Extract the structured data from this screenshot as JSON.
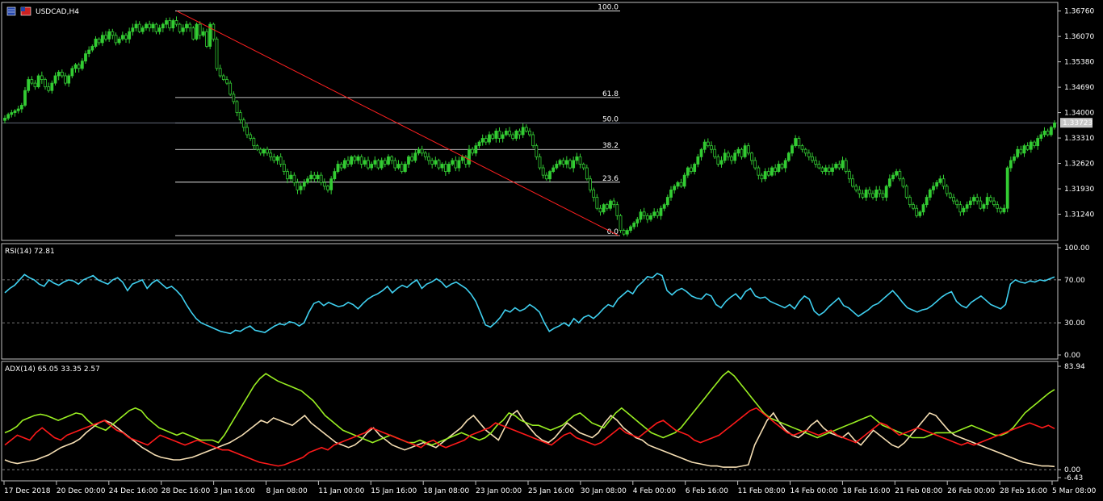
{
  "window": {
    "title": "USDCAD,H4"
  },
  "colors": {
    "background": "#000000",
    "frame": "#c0c0c0",
    "candle": "#33cc33",
    "candle_fill_down": "#000000",
    "fib": "#ffffff",
    "trendline": "#ff2020",
    "rsi": "#3fd0f0",
    "adx_main": "#f5deb3",
    "adx_plus": "#99ee22",
    "adx_minus": "#ff1a1a",
    "price_marker_bg": "#c8c8c8",
    "price_marker_text": "#000000"
  },
  "chart_data": [
    {
      "type": "candlestick",
      "title": "USDCAD,H4",
      "ylim": [
        1.3055,
        1.3695
      ],
      "yticks": [
        "1.36760",
        "1.36070",
        "1.35380",
        "1.34690",
        "1.34000",
        "1.33310",
        "1.32620",
        "1.31930",
        "1.31240"
      ],
      "ytick_values": [
        1.3676,
        1.3607,
        1.3538,
        1.3469,
        1.34,
        1.3331,
        1.3262,
        1.3193,
        1.3124
      ],
      "current_price": {
        "label": "1.33723",
        "value": 1.33723
      },
      "fibonacci": [
        {
          "label": "100.0",
          "price": 1.3676
        },
        {
          "label": "61.8",
          "price": 1.3441
        },
        {
          "label": "50.0",
          "price": 1.3372
        },
        {
          "label": "38.2",
          "price": 1.33
        },
        {
          "label": "23.6",
          "price": 1.3211
        },
        {
          "label": "0.0",
          "price": 1.3066
        }
      ],
      "closes": [
        1.3385,
        1.3395,
        1.34,
        1.3405,
        1.341,
        1.342,
        1.346,
        1.349,
        1.348,
        1.347,
        1.35,
        1.349,
        1.347,
        1.346,
        1.348,
        1.35,
        1.351,
        1.35,
        1.348,
        1.35,
        1.352,
        1.353,
        1.352,
        1.354,
        1.356,
        1.357,
        1.358,
        1.36,
        1.359,
        1.361,
        1.36,
        1.362,
        1.361,
        1.359,
        1.36,
        1.361,
        1.36,
        1.362,
        1.363,
        1.364,
        1.362,
        1.363,
        1.364,
        1.363,
        1.364,
        1.362,
        1.363,
        1.364,
        1.365,
        1.363,
        1.365,
        1.364,
        1.362,
        1.363,
        1.364,
        1.363,
        1.36,
        1.364,
        1.361,
        1.362,
        1.358,
        1.364,
        1.36,
        1.352,
        1.35,
        1.349,
        1.348,
        1.345,
        1.343,
        1.34,
        1.338,
        1.336,
        1.334,
        1.333,
        1.331,
        1.33,
        1.329,
        1.33,
        1.329,
        1.328,
        1.327,
        1.328,
        1.326,
        1.324,
        1.322,
        1.323,
        1.321,
        1.319,
        1.32,
        1.321,
        1.322,
        1.323,
        1.322,
        1.323,
        1.321,
        1.32,
        1.319,
        1.322,
        1.324,
        1.326,
        1.325,
        1.327,
        1.326,
        1.328,
        1.327,
        1.328,
        1.326,
        1.327,
        1.325,
        1.326,
        1.327,
        1.325,
        1.327,
        1.326,
        1.328,
        1.327,
        1.325,
        1.326,
        1.324,
        1.326,
        1.328,
        1.327,
        1.329,
        1.33,
        1.329,
        1.328,
        1.327,
        1.326,
        1.327,
        1.325,
        1.326,
        1.324,
        1.326,
        1.327,
        1.325,
        1.327,
        1.328,
        1.326,
        1.33,
        1.329,
        1.331,
        1.332,
        1.333,
        1.332,
        1.334,
        1.333,
        1.335,
        1.333,
        1.334,
        1.335,
        1.334,
        1.333,
        1.335,
        1.334,
        1.336,
        1.335,
        1.334,
        1.331,
        1.328,
        1.325,
        1.323,
        1.322,
        1.324,
        1.325,
        1.326,
        1.327,
        1.326,
        1.327,
        1.325,
        1.327,
        1.328,
        1.326,
        1.325,
        1.322,
        1.319,
        1.317,
        1.314,
        1.313,
        1.315,
        1.314,
        1.316,
        1.315,
        1.312,
        1.308,
        1.307,
        1.308,
        1.309,
        1.31,
        1.311,
        1.313,
        1.312,
        1.311,
        1.312,
        1.313,
        1.312,
        1.314,
        1.315,
        1.317,
        1.319,
        1.32,
        1.321,
        1.32,
        1.323,
        1.325,
        1.324,
        1.326,
        1.328,
        1.33,
        1.332,
        1.331,
        1.33,
        1.328,
        1.326,
        1.327,
        1.329,
        1.328,
        1.327,
        1.329,
        1.33,
        1.328,
        1.331,
        1.329,
        1.327,
        1.325,
        1.323,
        1.322,
        1.324,
        1.323,
        1.325,
        1.324,
        1.326,
        1.325,
        1.327,
        1.329,
        1.331,
        1.333,
        1.331,
        1.33,
        1.329,
        1.328,
        1.327,
        1.326,
        1.325,
        1.324,
        1.325,
        1.324,
        1.325,
        1.326,
        1.325,
        1.327,
        1.324,
        1.322,
        1.32,
        1.319,
        1.318,
        1.317,
        1.319,
        1.318,
        1.317,
        1.319,
        1.318,
        1.317,
        1.32,
        1.322,
        1.323,
        1.324,
        1.322,
        1.32,
        1.317,
        1.315,
        1.314,
        1.312,
        1.313,
        1.315,
        1.317,
        1.319,
        1.32,
        1.321,
        1.322,
        1.32,
        1.318,
        1.317,
        1.316,
        1.315,
        1.313,
        1.314,
        1.315,
        1.316,
        1.317,
        1.316,
        1.314,
        1.315,
        1.317,
        1.316,
        1.315,
        1.314,
        1.313,
        1.314,
        1.325,
        1.327,
        1.328,
        1.33,
        1.329,
        1.331,
        1.33,
        1.332,
        1.331,
        1.333,
        1.334,
        1.335,
        1.334,
        1.336,
        1.3372
      ]
    },
    {
      "type": "line",
      "title": "RSI(14) 72.81",
      "ylim": [
        0,
        100
      ],
      "yticks": [
        "100.00",
        "70.00",
        "30.00",
        "0.00"
      ],
      "ytick_values": [
        100,
        70,
        30,
        0
      ],
      "levels": [
        70,
        30
      ],
      "series": [
        {
          "values": [
            58,
            62,
            65,
            70,
            75,
            72,
            70,
            66,
            64,
            70,
            67,
            65,
            68,
            70,
            69,
            66,
            70,
            72,
            74,
            70,
            68,
            66,
            70,
            72,
            68,
            60,
            66,
            68,
            70,
            62,
            67,
            70,
            66,
            62,
            64,
            60,
            55,
            47,
            40,
            34,
            30,
            28,
            26,
            24,
            22,
            21,
            20,
            23,
            22,
            25,
            27,
            23,
            22,
            21,
            24,
            27,
            29,
            28,
            31,
            30,
            27,
            30,
            40,
            48,
            50,
            46,
            49,
            47,
            45,
            46,
            49,
            47,
            43,
            48,
            52,
            55,
            57,
            60,
            64,
            58,
            62,
            65,
            63,
            67,
            70,
            62,
            66,
            68,
            71,
            68,
            63,
            66,
            68,
            65,
            62,
            57,
            50,
            39,
            28,
            26,
            30,
            35,
            42,
            40,
            44,
            41,
            43,
            47,
            44,
            40,
            30,
            22,
            25,
            27,
            30,
            27,
            34,
            30,
            35,
            37,
            34,
            38,
            43,
            47,
            45,
            52,
            56,
            60,
            57,
            64,
            68,
            73,
            72,
            76,
            74,
            60,
            56,
            60,
            62,
            59,
            55,
            53,
            52,
            57,
            55,
            47,
            44,
            50,
            54,
            57,
            52,
            59,
            62,
            55,
            53,
            54,
            50,
            48,
            46,
            44,
            47,
            43,
            50,
            55,
            52,
            41,
            37,
            40,
            45,
            49,
            53,
            46,
            44,
            40,
            36,
            39,
            42,
            46,
            48,
            52,
            56,
            60,
            55,
            49,
            44,
            42,
            40,
            42,
            43,
            46,
            50,
            54,
            57,
            59,
            50,
            46,
            44,
            49,
            52,
            55,
            51,
            47,
            45,
            43,
            47,
            66,
            70,
            68,
            67,
            69,
            68,
            70,
            69,
            71,
            72.81
          ]
        }
      ]
    },
    {
      "type": "line",
      "title": "ADX(14) 65.05 33.35 2.57",
      "ylim": [
        -6.43,
        83.94
      ],
      "yticks": [
        "83.94",
        "0.00",
        "-6.43"
      ],
      "ytick_values": [
        83.94,
        0,
        -6.43
      ],
      "level": 0,
      "series": [
        {
          "values": [
            8,
            6,
            5,
            6,
            7,
            8,
            10,
            12,
            15,
            18,
            20,
            22,
            25,
            30,
            34,
            38,
            40,
            38,
            34,
            30,
            26,
            22,
            18,
            15,
            12,
            10,
            9,
            8,
            8,
            9,
            10,
            12,
            14,
            16,
            18,
            20,
            22,
            25,
            28,
            32,
            36,
            40,
            38,
            42,
            40,
            38,
            36,
            40,
            44,
            38,
            34,
            30,
            26,
            22,
            20,
            18,
            20,
            24,
            30,
            34,
            28,
            24,
            20,
            18,
            16,
            18,
            20,
            22,
            20,
            18,
            22,
            26,
            30,
            34,
            40,
            44,
            38,
            32,
            28,
            24,
            34,
            44,
            48,
            40,
            34,
            28,
            24,
            22,
            26,
            32,
            38,
            34,
            30,
            28,
            26,
            30,
            38,
            44,
            40,
            34,
            30,
            26,
            24,
            20,
            18,
            16,
            14,
            12,
            10,
            8,
            6,
            5,
            4,
            3,
            3,
            2,
            2,
            2,
            3,
            4,
            20,
            30,
            40,
            46,
            38,
            32,
            28,
            26,
            30,
            36,
            40,
            34,
            30,
            28,
            26,
            30,
            24,
            20,
            26,
            32,
            28,
            24,
            20,
            18,
            22,
            28,
            34,
            40,
            46,
            44,
            38,
            32,
            28,
            26,
            24,
            22,
            20,
            18,
            16,
            14,
            12,
            10,
            8,
            6,
            5,
            4,
            3,
            3,
            2.57
          ]
        },
        {
          "values": [
            30,
            32,
            35,
            40,
            42,
            44,
            45,
            44,
            42,
            40,
            42,
            44,
            46,
            45,
            40,
            36,
            34,
            32,
            36,
            40,
            44,
            48,
            50,
            48,
            42,
            38,
            34,
            32,
            30,
            28,
            30,
            28,
            26,
            24,
            24,
            24,
            22,
            28,
            36,
            44,
            52,
            60,
            68,
            74,
            78,
            75,
            72,
            70,
            68,
            66,
            64,
            60,
            56,
            50,
            44,
            40,
            36,
            32,
            30,
            28,
            26,
            24,
            22,
            24,
            26,
            28,
            26,
            24,
            22,
            22,
            24,
            22,
            20,
            22,
            24,
            26,
            28,
            30,
            28,
            26,
            24,
            26,
            30,
            36,
            40,
            46,
            44,
            40,
            38,
            36,
            36,
            34,
            32,
            34,
            36,
            40,
            44,
            46,
            42,
            38,
            36,
            34,
            40,
            46,
            50,
            46,
            42,
            38,
            34,
            30,
            28,
            26,
            28,
            30,
            34,
            40,
            46,
            52,
            58,
            64,
            70,
            76,
            80,
            76,
            70,
            64,
            58,
            52,
            46,
            42,
            40,
            38,
            36,
            34,
            32,
            30,
            28,
            26,
            28,
            30,
            32,
            34,
            36,
            38,
            40,
            42,
            44,
            40,
            36,
            34,
            32,
            30,
            28,
            26,
            26,
            26,
            28,
            30,
            30,
            30,
            30,
            32,
            34,
            36,
            34,
            32,
            30,
            28,
            28,
            30,
            34,
            40,
            46,
            50,
            54,
            58,
            62,
            65.05
          ]
        },
        {
          "values": [
            20,
            24,
            28,
            26,
            24,
            30,
            34,
            30,
            26,
            24,
            28,
            30,
            32,
            34,
            36,
            38,
            40,
            36,
            32,
            30,
            26,
            24,
            22,
            20,
            24,
            28,
            26,
            24,
            22,
            20,
            22,
            24,
            22,
            20,
            18,
            16,
            16,
            14,
            12,
            10,
            8,
            6,
            5,
            4,
            3,
            4,
            6,
            8,
            10,
            14,
            16,
            18,
            16,
            20,
            22,
            24,
            26,
            28,
            30,
            34,
            32,
            30,
            28,
            26,
            24,
            22,
            20,
            18,
            22,
            24,
            20,
            18,
            20,
            22,
            24,
            28,
            30,
            32,
            34,
            38,
            36,
            34,
            32,
            30,
            28,
            26,
            24,
            22,
            20,
            24,
            28,
            30,
            26,
            24,
            22,
            20,
            22,
            26,
            30,
            34,
            30,
            28,
            26,
            30,
            34,
            38,
            40,
            36,
            32,
            30,
            28,
            24,
            22,
            24,
            26,
            28,
            32,
            36,
            40,
            44,
            48,
            50,
            46,
            42,
            38,
            34,
            30,
            28,
            30,
            32,
            30,
            28,
            30,
            32,
            28,
            26,
            24,
            22,
            26,
            30,
            34,
            38,
            36,
            32,
            28,
            30,
            32,
            34,
            32,
            30,
            28,
            26,
            24,
            22,
            20,
            22,
            20,
            22,
            24,
            26,
            28,
            30,
            32,
            34,
            36,
            38,
            36,
            34,
            36,
            33.35
          ]
        }
      ]
    }
  ],
  "xaxis": {
    "labels": [
      "17 Dec 2018",
      "20 Dec 00:00",
      "24 Dec 16:00",
      "28 Dec 16:00",
      "3 Jan 16:00",
      "8 Jan 08:00",
      "11 Jan 00:00",
      "15 Jan 16:00",
      "18 Jan 08:00",
      "23 Jan 00:00",
      "25 Jan 16:00",
      "30 Jan 08:00",
      "4 Feb 00:00",
      "6 Feb 16:00",
      "11 Feb 08:00",
      "14 Feb 00:00",
      "18 Feb 16:00",
      "21 Feb 08:00",
      "26 Feb 00:00",
      "28 Feb 16:00",
      "5 Mar 08:00"
    ]
  }
}
